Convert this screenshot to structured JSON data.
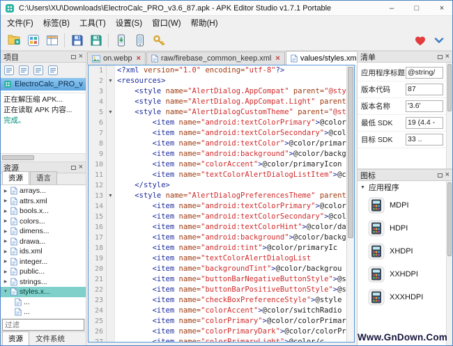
{
  "window": {
    "title": "C:\\Users\\XU\\Downloads\\ElectroCalc_PRO_v3.6_87.apk - APK Editor Studio v1.7.1 Portable",
    "minimize": "–",
    "maximize": "□",
    "close": "×"
  },
  "menubar": [
    "文件(F)",
    "标签(B)",
    "工具(T)",
    "设置(S)",
    "窗口(W)",
    "帮助(H)"
  ],
  "toolbar": {
    "groups": [
      [
        "open-apk-icon",
        "apk-grid-icon",
        "apk-table-icon"
      ],
      [
        "save-apk-icon",
        "save-apk-as-icon"
      ],
      [
        "install-apk-icon",
        "device-manager-icon",
        "key-manager-icon"
      ]
    ],
    "right": [
      "donate-heart-icon",
      "collapse-panels-icon"
    ]
  },
  "project_panel": {
    "title": "项目",
    "root_item": "ElectroCalc_PRO_v",
    "log": [
      {
        "text": "正在解压缩 APK...",
        "color": "#1a1a1a"
      },
      {
        "text": "正在读取 APK 内容...",
        "color": "#1a1a1a"
      },
      {
        "text": "完成。",
        "color": "#00917e"
      }
    ]
  },
  "resources_panel": {
    "title": "资源",
    "tabs": [
      "资源",
      "语言"
    ],
    "active_tab": 0,
    "items": [
      {
        "label": "arrays..."
      },
      {
        "label": "attrs.xml"
      },
      {
        "label": "bools.x..."
      },
      {
        "label": "colors..."
      },
      {
        "label": "dimens..."
      },
      {
        "label": "drawa..."
      },
      {
        "label": "ids.xml"
      },
      {
        "label": "integer..."
      },
      {
        "label": "public..."
      },
      {
        "label": "strings..."
      },
      {
        "label": "styles.x...",
        "selected": true,
        "expanded": true,
        "children": [
          "...",
          "..."
        ]
      }
    ],
    "filter_placeholder": "过滤"
  },
  "editor": {
    "tabs": [
      {
        "label": "on.webp",
        "icon": "image-icon",
        "closable": true,
        "active": false
      },
      {
        "label": "raw/firebase_common_keep.xml",
        "icon": "xml-file-icon",
        "closable": true,
        "active": false
      },
      {
        "label": "values/styles.xml",
        "icon": "xml-file-icon",
        "closable": true,
        "active": true
      }
    ],
    "fold_lines": [
      2,
      5,
      13
    ],
    "lines": [
      [
        [
          "t",
          "<?xml "
        ],
        [
          "a",
          "version="
        ],
        [
          "s",
          "\"1.0\""
        ],
        [
          "a",
          " encoding="
        ],
        [
          "s",
          "\"utf-8\""
        ],
        [
          "t",
          "?>"
        ]
      ],
      [
        [
          "t",
          "<resources>"
        ]
      ],
      [
        [
          "p",
          "    "
        ],
        [
          "t",
          "<style "
        ],
        [
          "a",
          "name="
        ],
        [
          "s",
          "\"AlertDialog.AppCompat\""
        ],
        [
          "a",
          " parent="
        ],
        [
          "s",
          "\"@sty"
        ]
      ],
      [
        [
          "p",
          "    "
        ],
        [
          "t",
          "<style "
        ],
        [
          "a",
          "name="
        ],
        [
          "s",
          "\"AlertDialog.AppCompat.Light\""
        ],
        [
          "a",
          " parent="
        ],
        [
          "s",
          "\"@s"
        ]
      ],
      [
        [
          "p",
          "    "
        ],
        [
          "t",
          "<style "
        ],
        [
          "a",
          "name="
        ],
        [
          "s",
          "\"AlertDialogCustomTheme\""
        ],
        [
          "a",
          " parent="
        ],
        [
          "s",
          "\"@st"
        ]
      ],
      [
        [
          "p",
          "        "
        ],
        [
          "t",
          "<item "
        ],
        [
          "a",
          "name="
        ],
        [
          "s",
          "\"android:textColorPrimary\""
        ],
        [
          "t",
          ">"
        ],
        [
          "p",
          "@color"
        ]
      ],
      [
        [
          "p",
          "        "
        ],
        [
          "t",
          "<item "
        ],
        [
          "a",
          "name="
        ],
        [
          "s",
          "\"android:textColorSecondary\""
        ],
        [
          "t",
          ">"
        ],
        [
          "p",
          "@col"
        ]
      ],
      [
        [
          "p",
          "        "
        ],
        [
          "t",
          "<item "
        ],
        [
          "a",
          "name="
        ],
        [
          "s",
          "\"android:textColor\""
        ],
        [
          "t",
          ">"
        ],
        [
          "p",
          "@color/primar"
        ]
      ],
      [
        [
          "p",
          "        "
        ],
        [
          "t",
          "<item "
        ],
        [
          "a",
          "name="
        ],
        [
          "s",
          "\"android:background\""
        ],
        [
          "t",
          ">"
        ],
        [
          "p",
          "@color/backg"
        ]
      ],
      [
        [
          "p",
          "        "
        ],
        [
          "t",
          "<item "
        ],
        [
          "a",
          "name="
        ],
        [
          "s",
          "\"colorAccent\""
        ],
        [
          "t",
          ">"
        ],
        [
          "p",
          "@color/primaryIcon"
        ]
      ],
      [
        [
          "p",
          "        "
        ],
        [
          "t",
          "<item "
        ],
        [
          "a",
          "name="
        ],
        [
          "s",
          "\"textColorAlertDialogListItem\""
        ],
        [
          "t",
          ">"
        ],
        [
          "p",
          "@c"
        ]
      ],
      [
        [
          "p",
          "    "
        ],
        [
          "t",
          "</style>"
        ]
      ],
      [
        [
          "p",
          "    "
        ],
        [
          "t",
          "<style "
        ],
        [
          "a",
          "name="
        ],
        [
          "s",
          "\"AlertDialogPreferencesTheme\""
        ],
        [
          "a",
          " parent"
        ]
      ],
      [
        [
          "p",
          "        "
        ],
        [
          "t",
          "<item "
        ],
        [
          "a",
          "name="
        ],
        [
          "s",
          "\"android:textColorPrimary\""
        ],
        [
          "t",
          ">"
        ],
        [
          "p",
          "@color"
        ]
      ],
      [
        [
          "p",
          "        "
        ],
        [
          "t",
          "<item "
        ],
        [
          "a",
          "name="
        ],
        [
          "s",
          "\"android:textColorSecondary\""
        ],
        [
          "t",
          ">"
        ],
        [
          "p",
          "@col"
        ]
      ],
      [
        [
          "p",
          "        "
        ],
        [
          "t",
          "<item "
        ],
        [
          "a",
          "name="
        ],
        [
          "s",
          "\"android:textColorHint\""
        ],
        [
          "t",
          ">"
        ],
        [
          "p",
          "@color/da"
        ]
      ],
      [
        [
          "p",
          "        "
        ],
        [
          "t",
          "<item "
        ],
        [
          "a",
          "name="
        ],
        [
          "s",
          "\"android:background\""
        ],
        [
          "t",
          ">"
        ],
        [
          "p",
          "@color/backg"
        ]
      ],
      [
        [
          "p",
          "        "
        ],
        [
          "t",
          "<item "
        ],
        [
          "a",
          "name="
        ],
        [
          "s",
          "\"android:tint\""
        ],
        [
          "t",
          ">"
        ],
        [
          "p",
          "@color/primaryIc"
        ]
      ],
      [
        [
          "p",
          "        "
        ],
        [
          "t",
          "<item "
        ],
        [
          "a",
          "name="
        ],
        [
          "s",
          "\"textColorAlertDialogList"
        ]
      ],
      [
        [
          "p",
          "        "
        ],
        [
          "t",
          "<item "
        ],
        [
          "a",
          "name="
        ],
        [
          "s",
          "\"backgroundTint\""
        ],
        [
          "t",
          ">"
        ],
        [
          "p",
          "@color/backgrou"
        ]
      ],
      [
        [
          "p",
          "        "
        ],
        [
          "t",
          "<item "
        ],
        [
          "a",
          "name="
        ],
        [
          "s",
          "\"buttonBarNegativeButtonStyle\""
        ],
        [
          "t",
          ">"
        ],
        [
          "p",
          "@s"
        ]
      ],
      [
        [
          "p",
          "        "
        ],
        [
          "t",
          "<item "
        ],
        [
          "a",
          "name="
        ],
        [
          "s",
          "\"buttonBarPositiveButtonStyle\""
        ],
        [
          "t",
          ">"
        ],
        [
          "p",
          "@s"
        ]
      ],
      [
        [
          "p",
          "        "
        ],
        [
          "t",
          "<item "
        ],
        [
          "a",
          "name="
        ],
        [
          "s",
          "\"checkBoxPreferenceStyle\""
        ],
        [
          "t",
          ">"
        ],
        [
          "p",
          "@style"
        ]
      ],
      [
        [
          "p",
          "        "
        ],
        [
          "t",
          "<item "
        ],
        [
          "a",
          "name="
        ],
        [
          "s",
          "\"colorAccent\""
        ],
        [
          "t",
          ">"
        ],
        [
          "p",
          "@color/switchRadio"
        ]
      ],
      [
        [
          "p",
          "        "
        ],
        [
          "t",
          "<item "
        ],
        [
          "a",
          "name="
        ],
        [
          "s",
          "\"colorPrimary\""
        ],
        [
          "t",
          ">"
        ],
        [
          "p",
          "@color/colorPrimar"
        ]
      ],
      [
        [
          "p",
          "        "
        ],
        [
          "t",
          "<item "
        ],
        [
          "a",
          "name="
        ],
        [
          "s",
          "\"colorPrimaryDark\""
        ],
        [
          "t",
          ">"
        ],
        [
          "p",
          "@color/colorPr"
        ]
      ],
      [
        [
          "p",
          "        "
        ],
        [
          "t",
          "<item "
        ],
        [
          "a",
          "name="
        ],
        [
          "s",
          "\"colorPrimaryLight\""
        ],
        [
          "t",
          ">"
        ],
        [
          "p",
          "@color/c"
        ]
      ]
    ]
  },
  "manifest_panel": {
    "title": "清单",
    "fields": [
      {
        "label": "应用程序标题",
        "value": "@string/"
      },
      {
        "label": "版本代码",
        "value": "87"
      },
      {
        "label": "版本名称",
        "value": "'3.6'"
      },
      {
        "label": "最低 SDK",
        "value": "19 (4.4 -"
      },
      {
        "label": "目标 SDK",
        "value": "33 .."
      }
    ]
  },
  "icons_panel": {
    "title": "图标",
    "group_label": "应用程序",
    "items": [
      "MDPI",
      "HDPI",
      "XHDPI",
      "XXHDPI",
      "XXXHDPI"
    ]
  },
  "bottom": {
    "dock_tabs": [
      "资源",
      "文件系统"
    ],
    "active_dock_tab": 0,
    "watermark": "Www.GnDown.Com"
  },
  "colors": {
    "selection_blue": "#5fa7e0",
    "selection_teal": "#7fd0ca",
    "log_success": "#00917e",
    "tab_close_red": "#c43b3b",
    "editor_focus_border": "#5596d8"
  }
}
